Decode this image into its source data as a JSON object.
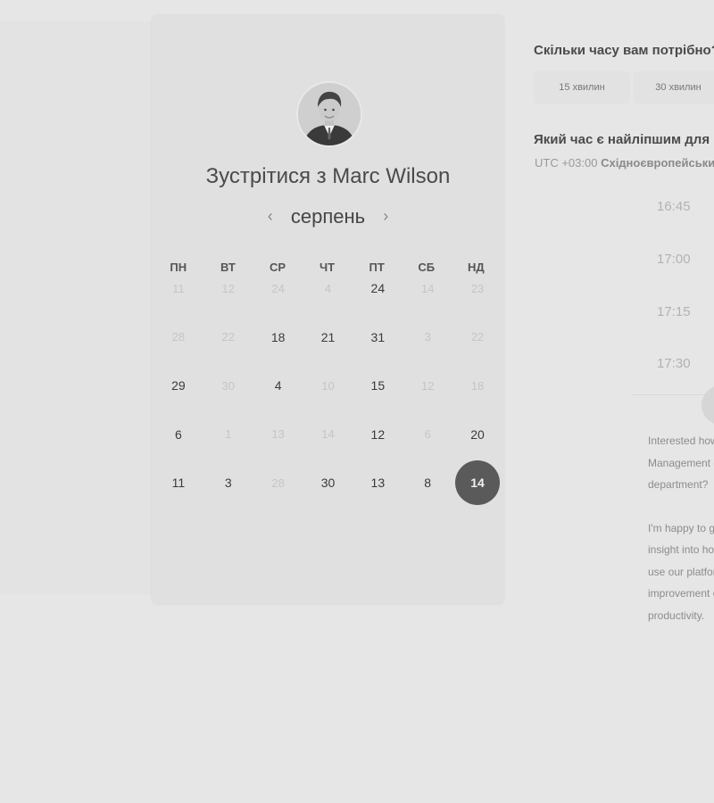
{
  "booking": {
    "title": "Зустрітися з Marc Wilson",
    "month": "серпень",
    "prev_arrow": "‹",
    "next_arrow": "›",
    "weekdays": [
      "ПН",
      "ВТ",
      "СР",
      "ЧТ",
      "ПТ",
      "СБ",
      "НД"
    ],
    "weeks": [
      [
        {
          "d": "11",
          "s": "muted"
        },
        {
          "d": "12",
          "s": "muted"
        },
        {
          "d": "24",
          "s": "muted"
        },
        {
          "d": "4",
          "s": "muted"
        },
        {
          "d": "24",
          "s": "active"
        },
        {
          "d": "14",
          "s": "muted"
        },
        {
          "d": "23",
          "s": "muted"
        }
      ],
      [
        {
          "d": "28",
          "s": "muted"
        },
        {
          "d": "22",
          "s": "muted"
        },
        {
          "d": "18",
          "s": "active"
        },
        {
          "d": "21",
          "s": "active"
        },
        {
          "d": "31",
          "s": "active"
        },
        {
          "d": "3",
          "s": "muted"
        },
        {
          "d": "22",
          "s": "muted"
        }
      ],
      [
        {
          "d": "29",
          "s": "active"
        },
        {
          "d": "30",
          "s": "muted"
        },
        {
          "d": "4",
          "s": "active"
        },
        {
          "d": "10",
          "s": "muted"
        },
        {
          "d": "15",
          "s": "active"
        },
        {
          "d": "12",
          "s": "muted"
        },
        {
          "d": "18",
          "s": "muted"
        }
      ],
      [
        {
          "d": "6",
          "s": "active"
        },
        {
          "d": "1",
          "s": "muted"
        },
        {
          "d": "13",
          "s": "muted"
        },
        {
          "d": "14",
          "s": "muted"
        },
        {
          "d": "12",
          "s": "active"
        },
        {
          "d": "6",
          "s": "muted"
        },
        {
          "d": "20",
          "s": "active"
        }
      ],
      [
        {
          "d": "11",
          "s": "active"
        },
        {
          "d": "3",
          "s": "active"
        },
        {
          "d": "28",
          "s": "muted"
        },
        {
          "d": "30",
          "s": "active"
        },
        {
          "d": "13",
          "s": "active"
        },
        {
          "d": "8",
          "s": "active"
        },
        {
          "d": "14",
          "s": "selected"
        }
      ]
    ]
  },
  "scheduler": {
    "duration_question": "Скільки часу вам потрібно?",
    "durations": [
      "15 хвилин",
      "30 хвилин"
    ],
    "time_question": "Який час є найліпшим для вас?",
    "timezone_offset": "UTC +03:00",
    "timezone_name": "Східноєвропейський час",
    "slots": [
      "16:45",
      "17:00",
      "17:15",
      "17:30"
    ]
  },
  "description": {
    "paragraph1": [
      "Interested how Time",
      "Management could help your",
      "department?"
    ],
    "paragraph2": [
      "I'm happy to give you",
      "insight into how our clients",
      "use our platform for the",
      "improvement of",
      "productivity."
    ]
  }
}
